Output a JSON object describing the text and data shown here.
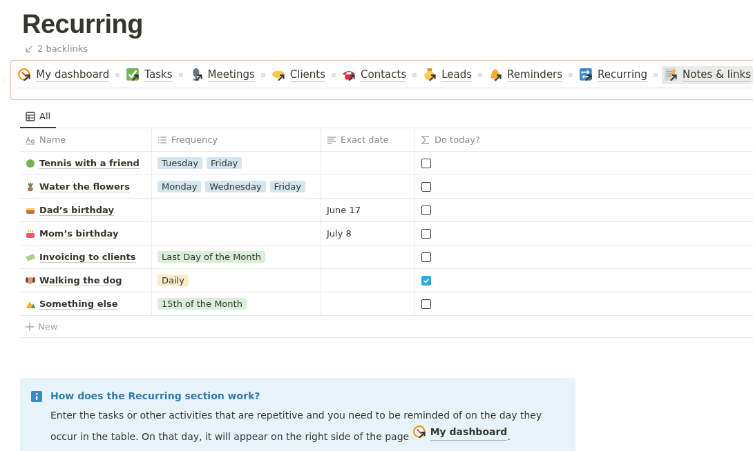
{
  "title": "Recurring",
  "backlinks": "2 backlinks",
  "links": [
    {
      "label": "My dashboard",
      "selected": false
    },
    {
      "label": "Tasks",
      "selected": false
    },
    {
      "label": "Meetings",
      "selected": false
    },
    {
      "label": "Clients",
      "selected": false
    },
    {
      "label": "Contacts",
      "selected": false
    },
    {
      "label": "Leads",
      "selected": false
    },
    {
      "label": "Reminders",
      "selected": false
    },
    {
      "label": "Recurring",
      "selected": false
    },
    {
      "label": "Notes & links",
      "selected": true
    }
  ],
  "view_tabs": [
    {
      "label": "All",
      "selected": true
    }
  ],
  "table": {
    "columns": [
      "Name",
      "Frequency",
      "Exact date",
      "Do today?"
    ],
    "rows": [
      {
        "name": "Tennis with a friend",
        "frequency": [
          {
            "label": "Tuesday",
            "color": "#d3e5ef"
          },
          {
            "label": "Friday",
            "color": "#d3e5ef"
          }
        ],
        "date": "",
        "checked": false
      },
      {
        "name": "Water the flowers",
        "frequency": [
          {
            "label": "Monday",
            "color": "#d3e5ef"
          },
          {
            "label": "Wednesday",
            "color": "#d3e5ef"
          },
          {
            "label": "Friday",
            "color": "#d3e5ef"
          }
        ],
        "date": "",
        "checked": false
      },
      {
        "name": "Dad’s birthday",
        "frequency": [],
        "date": "June 17",
        "checked": false
      },
      {
        "name": "Mom’s birthday",
        "frequency": [],
        "date": "July 8",
        "checked": false
      },
      {
        "name": "Invoicing to clients",
        "frequency": [
          {
            "label": "Last Day of the Month",
            "color": "#dbeddb"
          }
        ],
        "date": "",
        "checked": false
      },
      {
        "name": "Walking the dog",
        "frequency": [
          {
            "label": "Daily",
            "color": "#fdecc8"
          }
        ],
        "date": "",
        "checked": true
      },
      {
        "name": "Something else",
        "frequency": [
          {
            "label": "15th of the Month",
            "color": "#dbeddb"
          }
        ],
        "date": "",
        "checked": false
      }
    ],
    "new_label": "New"
  },
  "callout": {
    "title": "How does the Recurring section work?",
    "body": "Enter the tasks or other activities that are repetitive and you need to be reminded of on the day they occur in the table. On that day, it will appear on the right side of the page",
    "link": "My dashboard",
    "end": "."
  }
}
